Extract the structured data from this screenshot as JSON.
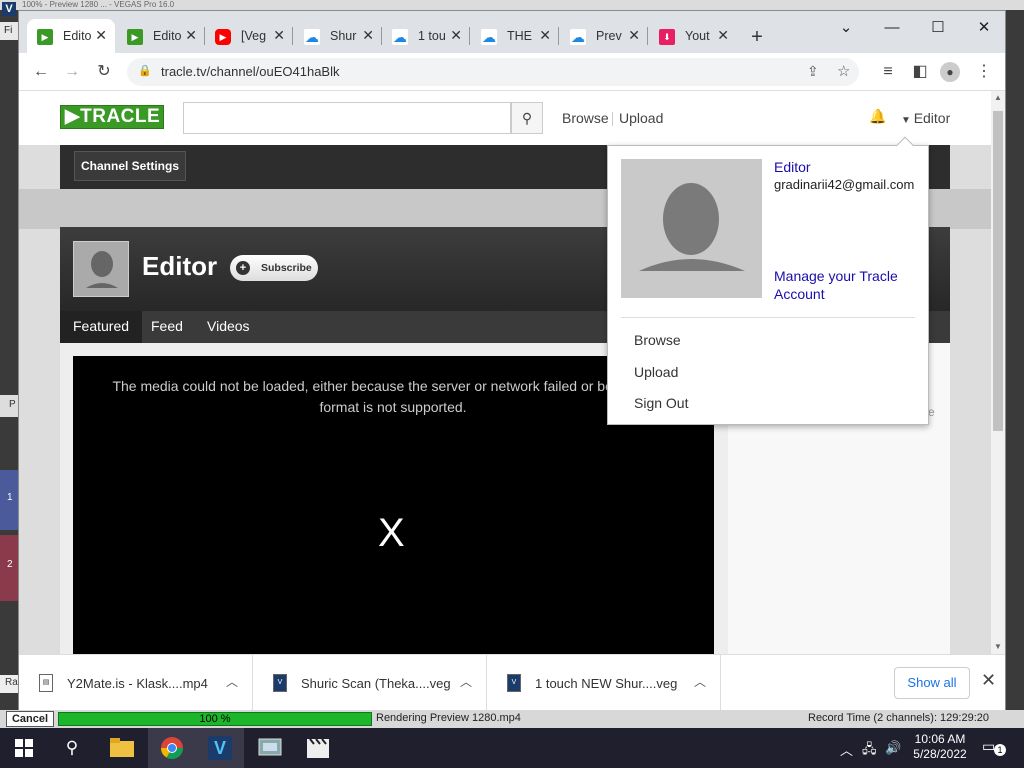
{
  "vegas": {
    "logo": "V",
    "title_fragment": "100% - Preview 1280 ... - VEGAS Pro 16.0",
    "menu_fragment": "Fi",
    "left_p": "P",
    "left_track1": "1",
    "left_track2": "2",
    "left_ra": "Ra",
    "cancel_label": "Cancel",
    "progress_label": "100 %",
    "progress_value": 100,
    "render_status": "Rendering Preview 1280.mp4",
    "record_time": "Record Time (2 channels): 129:29:20"
  },
  "browser": {
    "tabs": [
      {
        "label": "Edito",
        "icon": "tracle-icon",
        "active": true
      },
      {
        "label": "Edito",
        "icon": "tracle-icon",
        "active": false
      },
      {
        "label": "[Veg",
        "icon": "youtube-icon",
        "active": false
      },
      {
        "label": "Shur",
        "icon": "cloud-icon",
        "active": false
      },
      {
        "label": "1 tou",
        "icon": "cloud-icon",
        "active": false
      },
      {
        "label": "THE",
        "icon": "cloud-icon",
        "active": false
      },
      {
        "label": "Prev",
        "icon": "cloud-icon",
        "active": false
      },
      {
        "label": "Yout",
        "icon": "download-icon",
        "active": false
      }
    ],
    "url": "tracle.tv/channel/ouEO41haBlk",
    "colors": {
      "tracle_green": "#3b9a26",
      "youtube_red": "#ff0000",
      "cloud_blue": "#1e88e5",
      "download_pink": "#e91e63"
    }
  },
  "site": {
    "logo_text": "TRACLE",
    "search_placeholder": "",
    "nav": {
      "browse": "Browse",
      "upload": "Upload"
    },
    "user_label": "Editor",
    "channel_settings": "Channel Settings",
    "channel_name": "Editor",
    "subscribe_label": "Subscribe",
    "channel_tabs": [
      "Featured",
      "Feed",
      "Videos"
    ],
    "video_error": "The media could not be loaded, either because the server or network failed or because the format is not supported.",
    "video_x": "X",
    "side_fragment": "e"
  },
  "dropdown": {
    "name": "Editor",
    "email": "gradinarii42@gmail.com",
    "manage": "Manage your Tracle Account",
    "items": [
      "Browse",
      "Upload",
      "Sign Out"
    ]
  },
  "downloads": {
    "items": [
      {
        "name": "Y2Mate.is - Klask....mp4",
        "icon": "file-icon"
      },
      {
        "name": "Shuric Scan (Theka....veg",
        "icon": "veg-file-icon"
      },
      {
        "name": "1 touch NEW Shur....veg",
        "icon": "veg-file-icon"
      }
    ],
    "show_all": "Show all"
  },
  "taskbar": {
    "time": "10:06 AM",
    "date": "5/28/2022",
    "notification_count": "1"
  }
}
